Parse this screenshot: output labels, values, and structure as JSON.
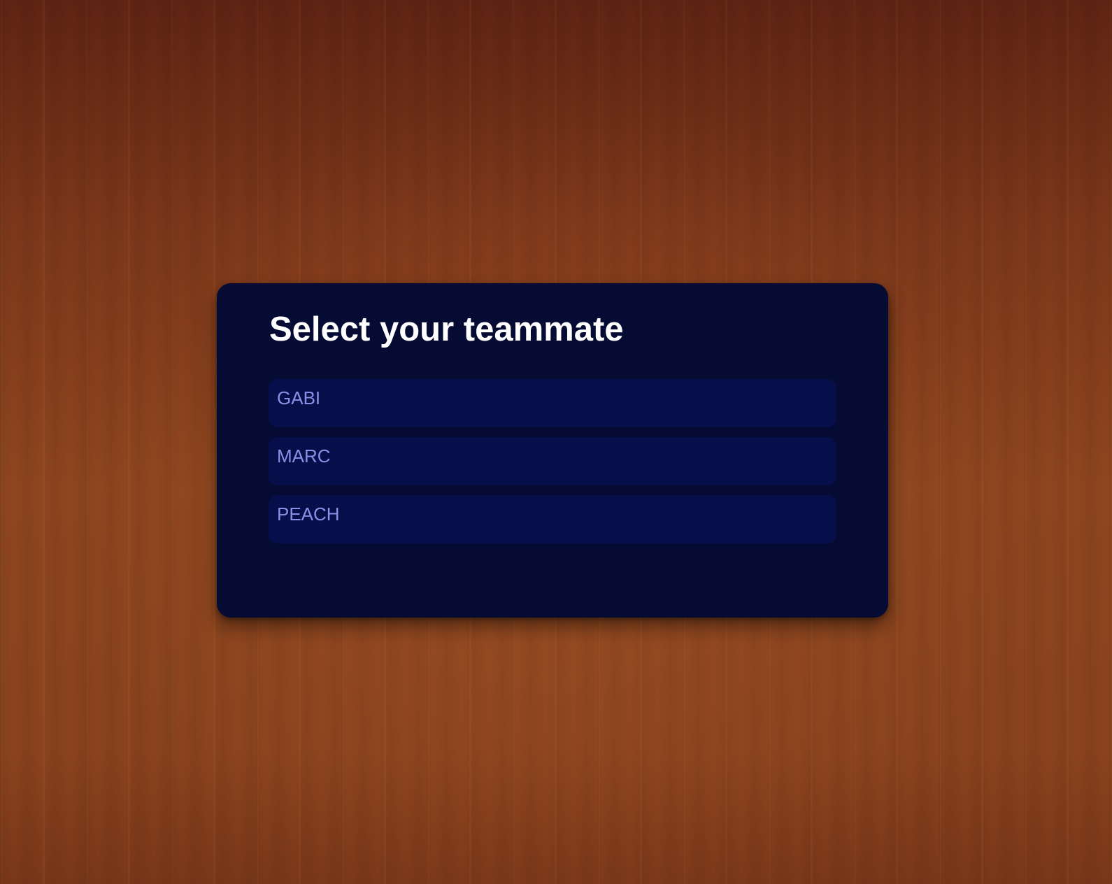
{
  "dialog": {
    "title": "Select your teammate",
    "options": [
      {
        "label": "GABI"
      },
      {
        "label": "MARC"
      },
      {
        "label": "PEACH"
      }
    ]
  },
  "colors": {
    "background": "#7a3a1a",
    "panel": "#060b33",
    "option_background": "#070f4a",
    "option_text": "#8b90e6",
    "title_text": "#ffffff"
  }
}
